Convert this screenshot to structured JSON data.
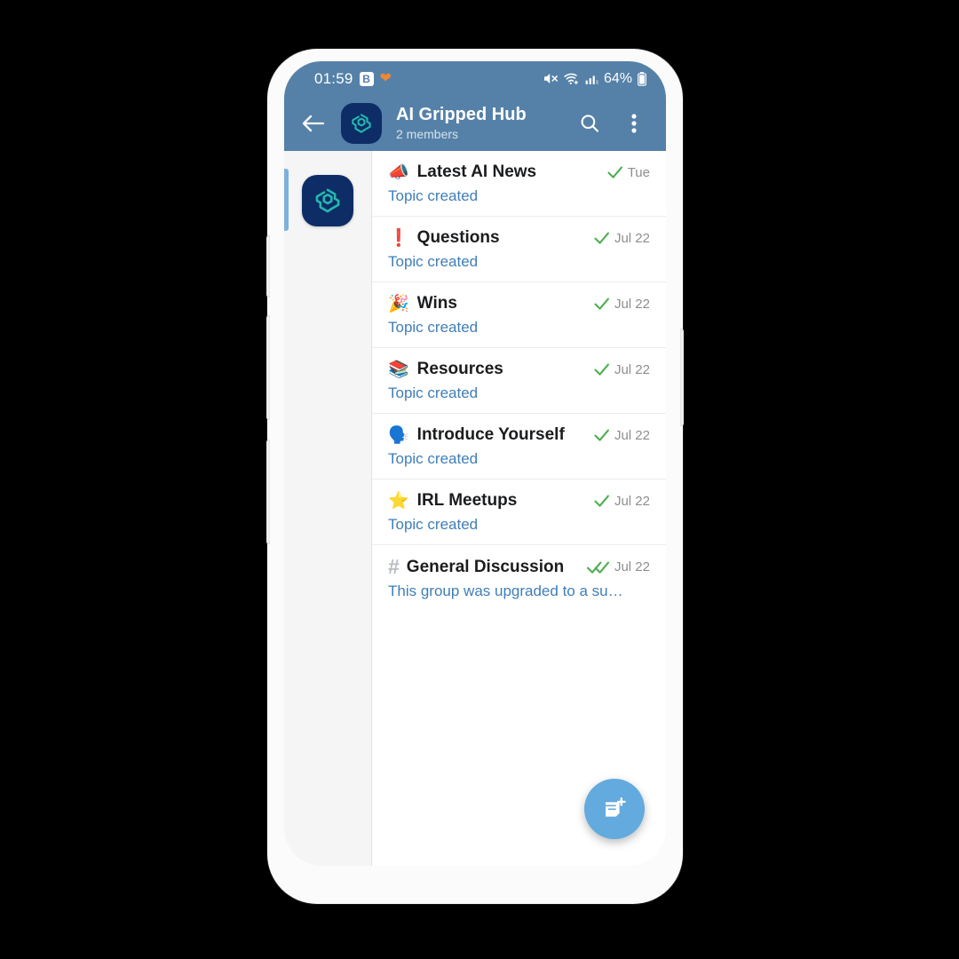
{
  "status_bar": {
    "time": "01:59",
    "b_badge": "B",
    "heart_icon": "heart-icon",
    "mute_icon": "volume-mute-icon",
    "wifi_icon": "wifi-plus-icon",
    "signal_icon": "cellular-signal-icon",
    "battery_percent": "64%",
    "battery_icon": "battery-icon"
  },
  "app_bar": {
    "back_icon": "arrow-left-icon",
    "avatar_icon": "ai-gripped-hub-logo",
    "title": "AI Gripped Hub",
    "subtitle": "2 members",
    "search_icon": "search-icon",
    "overflow_icon": "more-vertical-icon"
  },
  "rail": {
    "selected_chat": "AI Gripped Hub",
    "avatar_icon": "ai-gripped-hub-logo"
  },
  "topics": [
    {
      "emoji": "📣",
      "emoji_name": "megaphone-icon",
      "name": "Latest AI News",
      "preview": "Topic created",
      "date": "Tue",
      "read_state": "sent",
      "checks": 1
    },
    {
      "emoji": "❗",
      "emoji_name": "exclamation-question-icon",
      "name": "Questions",
      "preview": "Topic created",
      "date": "Jul 22",
      "read_state": "sent",
      "checks": 1
    },
    {
      "emoji": "🎉",
      "emoji_name": "party-popper-icon",
      "name": "Wins",
      "preview": "Topic created",
      "date": "Jul 22",
      "read_state": "sent",
      "checks": 1
    },
    {
      "emoji": "📚",
      "emoji_name": "books-icon",
      "name": "Resources",
      "preview": "Topic created",
      "date": "Jul 22",
      "read_state": "sent",
      "checks": 1
    },
    {
      "emoji": "🗣️",
      "emoji_name": "speaking-head-icon",
      "name": "Introduce Yourself",
      "preview": "Topic created",
      "date": "Jul 22",
      "read_state": "sent",
      "checks": 1
    },
    {
      "emoji": "⭐",
      "emoji_name": "star-icon",
      "name": "IRL Meetups",
      "preview": "Topic created",
      "date": "Jul 22",
      "read_state": "sent",
      "checks": 1
    },
    {
      "emoji": "#",
      "emoji_name": "hash-icon",
      "name": "General Discussion",
      "preview": "This group was upgraded to a su…",
      "date": "Jul 22",
      "read_state": "read",
      "checks": 2
    }
  ],
  "fab": {
    "icon": "new-topic-icon",
    "label": "New topic"
  },
  "nav_bar": {
    "recents_icon": "recents-icon",
    "home_icon": "home-icon",
    "back_icon": "chevron-left-icon"
  },
  "colors": {
    "app_bar": "#5581a8",
    "accent_blue": "#63aade",
    "preview_text": "#3f7eb8",
    "check_green": "#4caf50",
    "avatar_navy": "#0e2d66",
    "logo_teal": "#24b8ae",
    "rail_bg": "#f5f5f5"
  }
}
